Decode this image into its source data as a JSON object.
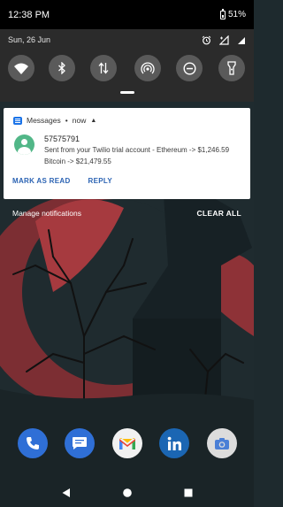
{
  "status_bar": {
    "time": "12:38 PM",
    "battery_percent": "51%"
  },
  "quick_settings": {
    "date": "Sun, 26 Jun",
    "tiles": [
      "wifi-icon",
      "bluetooth-icon",
      "mobile-data-icon",
      "hotspot-icon",
      "do-not-disturb-icon",
      "flashlight-icon"
    ],
    "tile_color": "#5a5a5a"
  },
  "notification": {
    "app_name": "Messages",
    "separator": "•",
    "time": "now",
    "sender": "57575791",
    "message": "Sent from your Twilio trial account - Ethereum -> $1,246.59 Bitcoin -> $21,479.55",
    "actions": {
      "mark_as_read": "MARK AS READ",
      "reply": "REPLY"
    },
    "accent_color": "#2b63b3"
  },
  "manage": {
    "manage_label": "Manage notifications",
    "clear_all_label": "CLEAR ALL"
  },
  "dock": {
    "apps": [
      "phone-icon",
      "messages-icon",
      "gmail-icon",
      "linkedin-icon",
      "camera-icon"
    ]
  },
  "navigation": {
    "buttons": [
      "back-icon",
      "home-icon",
      "recents-icon"
    ]
  }
}
